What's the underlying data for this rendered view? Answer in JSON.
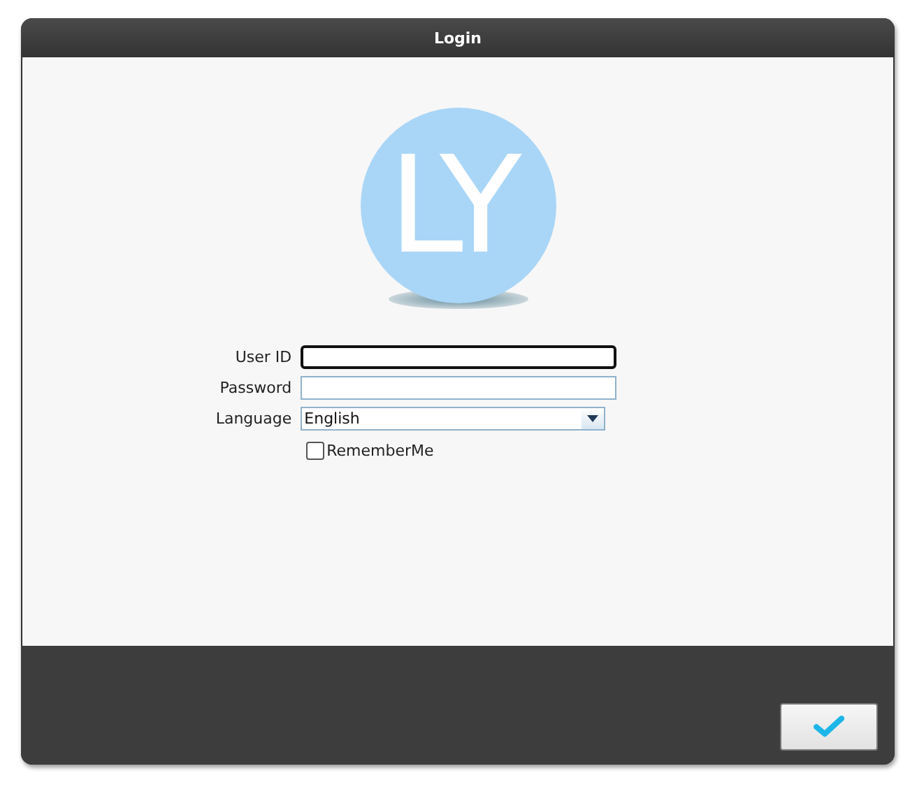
{
  "window": {
    "title": "Login"
  },
  "logo": {
    "text": "LY"
  },
  "fields": [
    {
      "kind": "text",
      "label": "User ID",
      "focused": true
    },
    {
      "kind": "password",
      "label": "Password",
      "focused": false
    },
    {
      "kind": "select",
      "label": "Language",
      "value": "English",
      "focused": false
    }
  ],
  "remember": {
    "label": "RememberMe",
    "checked": false
  }
}
